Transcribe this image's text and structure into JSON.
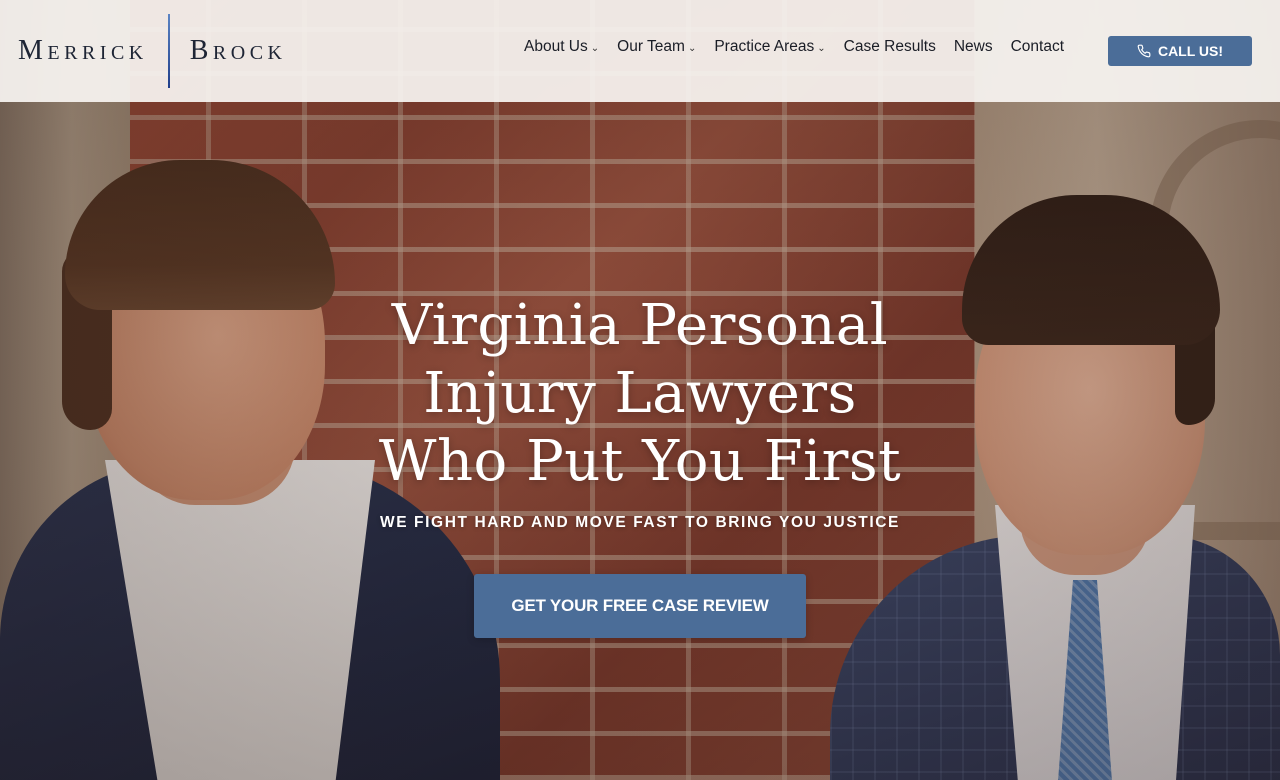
{
  "brand": {
    "name_left": "Merrick",
    "name_right": "Brock"
  },
  "nav": {
    "items": [
      {
        "label": "About Us",
        "dropdown": true
      },
      {
        "label": "Our Team",
        "dropdown": true
      },
      {
        "label": "Practice Areas",
        "dropdown": true
      },
      {
        "label": "Case Results",
        "dropdown": false
      },
      {
        "label": "News",
        "dropdown": false
      },
      {
        "label": "Contact",
        "dropdown": false
      }
    ],
    "call_button": {
      "label": "CALL US!",
      "icon": "phone-icon"
    }
  },
  "hero": {
    "headline_lines": [
      "Virginia Personal",
      "Injury Lawyers",
      "Who Put You First"
    ],
    "subheadline": "WE FIGHT HARD AND MOVE FAST TO BRING YOU JUSTICE",
    "cta_label": "GET YOUR FREE CASE REVIEW"
  },
  "colors": {
    "accent": "#4b6d98",
    "header_bg": "#f8f4f1",
    "logo_text": "#1e2535",
    "logo_divider": "#3c63b0"
  }
}
